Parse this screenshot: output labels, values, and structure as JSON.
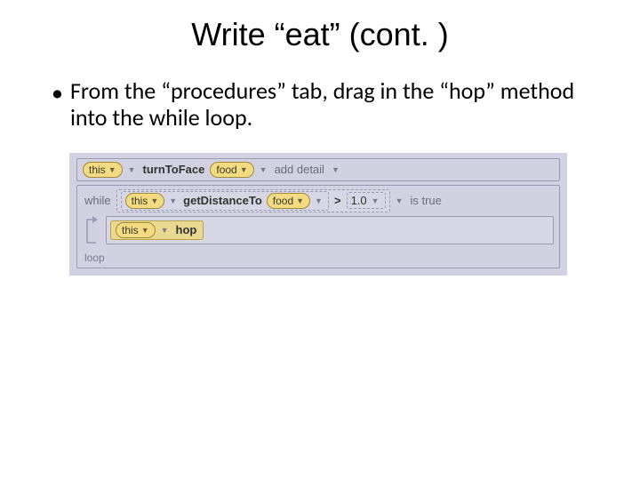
{
  "title": "Write “eat” (cont. )",
  "bullet": "From the “procedures” tab, drag in the “hop” method into the while loop.",
  "code": {
    "stmt1": {
      "target": "this",
      "method": "turnToFace",
      "arg": "food",
      "detail": "add detail"
    },
    "while_kw": "while",
    "cond": {
      "target": "this",
      "method": "getDistanceTo",
      "arg": "food",
      "op": ">",
      "rhs": "1.0"
    },
    "istrue": "is true",
    "body": {
      "target": "this",
      "method": "hop"
    },
    "loop_lbl": "loop"
  }
}
